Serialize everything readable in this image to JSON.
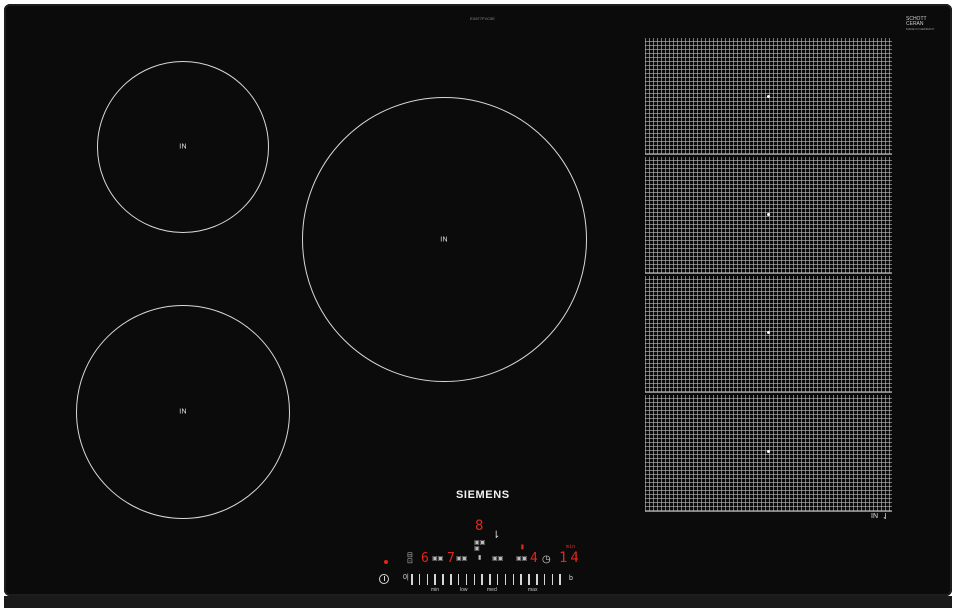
{
  "model_text": "EX877FVC5E",
  "schott_ceran": {
    "line1": "SCHOTT",
    "line2": "CERAN",
    "line3": "MADE IN GERMANY"
  },
  "zones": [
    {
      "label": "IN"
    },
    {
      "label": "IN"
    },
    {
      "label": "IN"
    }
  ],
  "flex_zone": {
    "label": "IN",
    "icon": "move-pan-icon"
  },
  "brand": "SIEMENS",
  "controls": {
    "left_display": "6",
    "display_2": "7",
    "display_center": "8",
    "display_right": "4",
    "timer_display": "14",
    "timer_unit": "min",
    "slider_start": "0|",
    "slider_end": "b",
    "slider_labels": [
      "min",
      "low",
      "med",
      "max"
    ]
  },
  "colors": {
    "glass": "#0b0b0c",
    "display_red": "#e0271b",
    "lines": "#d9d9d9"
  }
}
